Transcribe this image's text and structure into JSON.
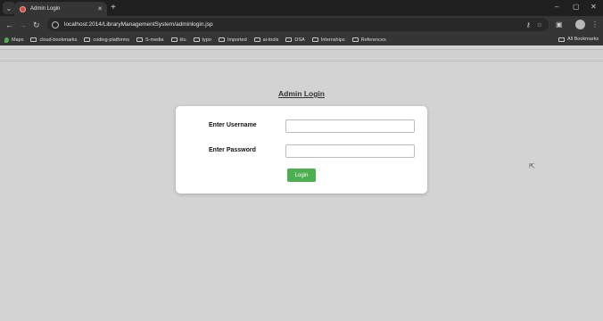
{
  "browser": {
    "tab": {
      "title": "Admin Login",
      "close": "✕"
    },
    "new_tab": "+",
    "window_controls": {
      "minimize": "–",
      "maximize": "▢",
      "close": "✕"
    },
    "toolbar": {
      "back": "←",
      "forward": "→",
      "reload": "↻",
      "url": "localhost:2014/LibraryManagementSystem/adminlogin.jsp",
      "key": "⚷",
      "star": "☆",
      "extensions": "▣",
      "menu": "⋮"
    },
    "bookmarks": [
      {
        "label": "Maps",
        "icon": "maps-pin-icon"
      },
      {
        "label": "cloud-bookmarks",
        "icon": "folder-icon"
      },
      {
        "label": "coding-platforms",
        "icon": "folder-icon"
      },
      {
        "label": "S-media",
        "icon": "folder-icon"
      },
      {
        "label": "klu",
        "icon": "folder-icon"
      },
      {
        "label": "typo",
        "icon": "folder-icon"
      },
      {
        "label": "Imported",
        "icon": "folder-icon"
      },
      {
        "label": "ai-tools",
        "icon": "folder-icon"
      },
      {
        "label": "DSA",
        "icon": "folder-icon"
      },
      {
        "label": "Internships",
        "icon": "folder-icon"
      },
      {
        "label": "References",
        "icon": "folder-icon"
      }
    ],
    "all_bookmarks": "All Bookmarks"
  },
  "page": {
    "title": "Admin Login",
    "username_label": "Enter Username",
    "username_value": "",
    "password_label": "Enter Password",
    "password_value": "",
    "login_button": "Login"
  },
  "colors": {
    "page_background": "#d3d3d3",
    "card_background": "#ffffff",
    "login_button": "#4caf50",
    "browser_chrome": "#353535"
  }
}
